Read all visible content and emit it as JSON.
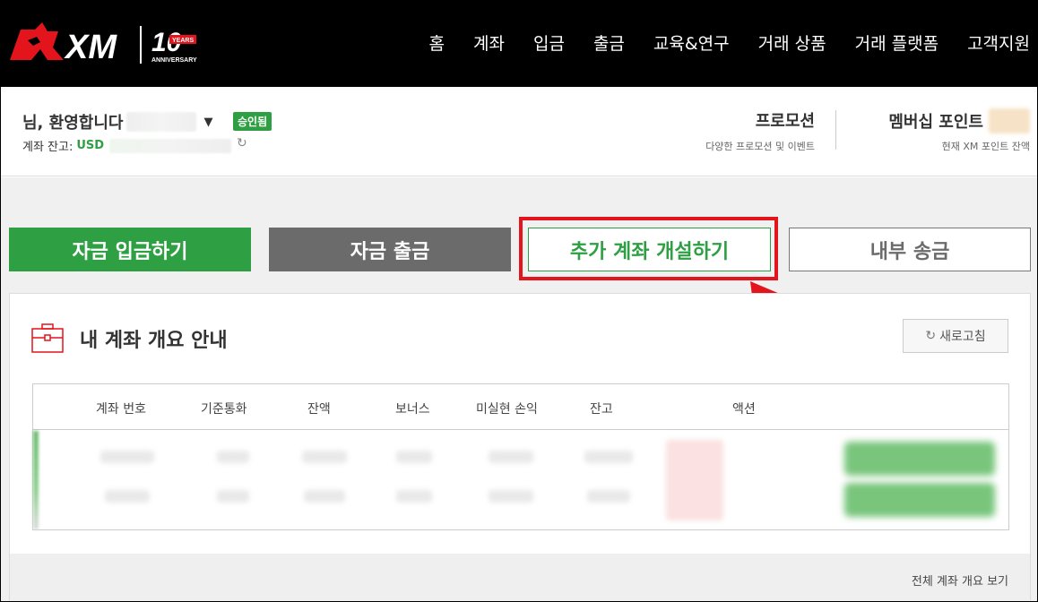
{
  "brand": {
    "name": "XM",
    "anniversary_number": "10",
    "anniversary_years": "YEARS",
    "anniversary_word": "ANNIVERSARY",
    "accent_red": "#e3141b",
    "accent_green": "#2ea043"
  },
  "nav": {
    "items": [
      "홈",
      "계좌",
      "입금",
      "출금",
      "교육&연구",
      "거래 상품",
      "거래 플랫폼",
      "고객지원"
    ]
  },
  "account": {
    "greeting": "님, 환영합니다",
    "status_badge": "승인됨",
    "balance_label": "계좌 잔고:",
    "currency": "USD"
  },
  "promo": {
    "title": "프로모션",
    "subtitle": "다양한 프로모션 및 이벤트"
  },
  "membership": {
    "title": "멤버십 포인트",
    "subtitle": "현재 XM 포인트 잔액"
  },
  "actions": {
    "deposit": "자금 입금하기",
    "withdraw": "자금 출금",
    "open_account": "추가 계좌 개설하기",
    "transfer": "내부 송금"
  },
  "overview": {
    "title": "내 계좌 개요 안내",
    "refresh": "새로고침",
    "columns": [
      "계좌 번호",
      "기준통화",
      "잔액",
      "보너스",
      "미실현 손익",
      "잔고",
      "액션"
    ],
    "view_all": "전체 계좌 개요 보기"
  },
  "icons": {
    "refresh": "refresh-icon",
    "caret": "caret-down-icon",
    "briefcase": "briefcase-icon",
    "arrow": "pointer-arrow-icon"
  }
}
